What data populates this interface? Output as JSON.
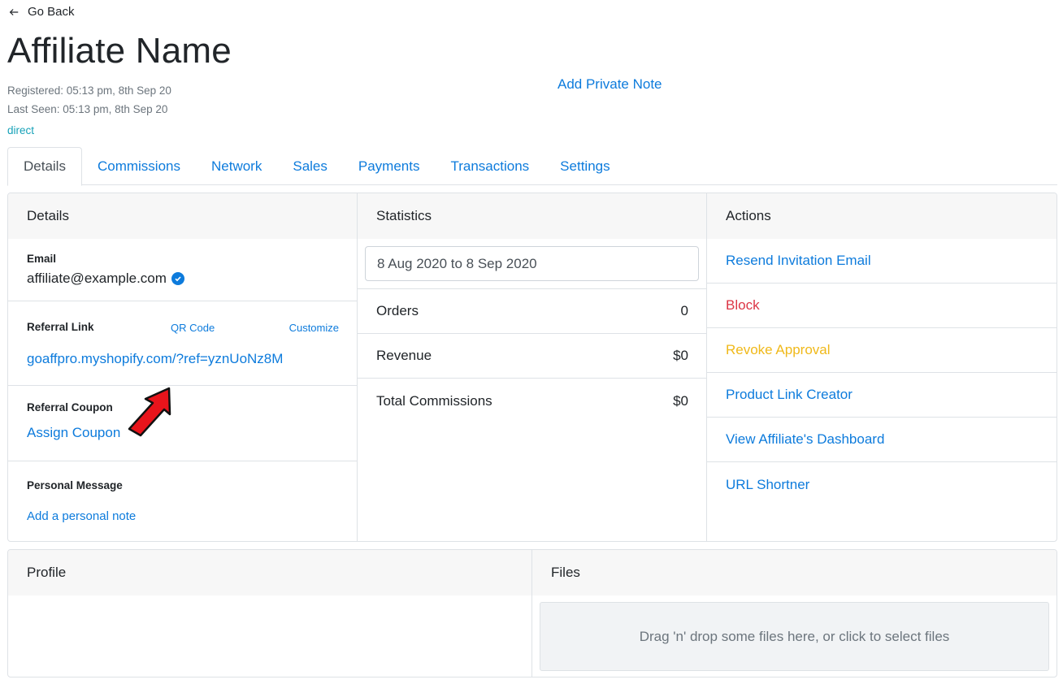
{
  "header": {
    "back_label": "Go Back",
    "title": "Affiliate Name",
    "registered": "Registered: 05:13 pm, 8th Sep 20",
    "last_seen": "Last Seen: 05:13 pm, 8th Sep 20",
    "source": "direct",
    "private_note": "Add Private Note"
  },
  "tabs": [
    "Details",
    "Commissions",
    "Network",
    "Sales",
    "Payments",
    "Transactions",
    "Settings"
  ],
  "details": {
    "heading": "Details",
    "email_label": "Email",
    "email_value": "affiliate@example.com",
    "referral_link_label": "Referral Link",
    "qr_code": "QR Code",
    "customize": "Customize",
    "referral_link": "goaffpro.myshopify.com/?ref=yznUoNz8M",
    "referral_coupon_label": "Referral Coupon",
    "assign_coupon": "Assign Coupon",
    "personal_message_label": "Personal Message",
    "add_note": "Add a personal note"
  },
  "statistics": {
    "heading": "Statistics",
    "date_range": "8 Aug 2020 to 8 Sep 2020",
    "rows": [
      {
        "label": "Orders",
        "value": "0"
      },
      {
        "label": "Revenue",
        "value": "$0"
      },
      {
        "label": "Total Commissions",
        "value": "$0"
      }
    ]
  },
  "actions": {
    "heading": "Actions",
    "items": [
      {
        "label": "Resend Invitation Email",
        "color": "#0d7bdc"
      },
      {
        "label": "Block",
        "color": "#dc3545"
      },
      {
        "label": "Revoke Approval",
        "color": "#f0b91a"
      },
      {
        "label": "Product Link Creator",
        "color": "#0d7bdc"
      },
      {
        "label": "View Affiliate's Dashboard",
        "color": "#0d7bdc"
      },
      {
        "label": "URL Shortner",
        "color": "#0d7bdc"
      }
    ]
  },
  "profile": {
    "heading": "Profile"
  },
  "files": {
    "heading": "Files",
    "dropzone": "Drag 'n' drop some files here, or click to select files"
  },
  "colors": {
    "link": "#0d7bdc",
    "danger": "#dc3545",
    "warning": "#f0b91a",
    "info": "#17a2b8",
    "annotation_arrow": "#e8141b"
  }
}
